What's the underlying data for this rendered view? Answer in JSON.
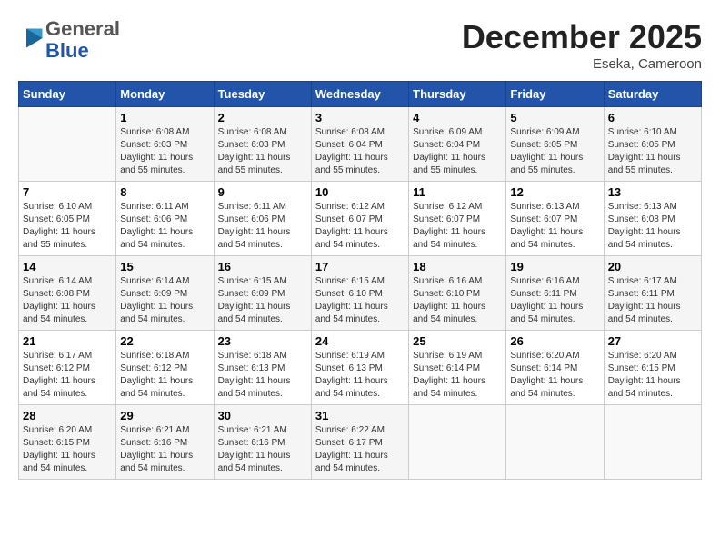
{
  "header": {
    "logo_general": "General",
    "logo_blue": "Blue",
    "month_title": "December 2025",
    "location": "Eseka, Cameroon"
  },
  "days_of_week": [
    "Sunday",
    "Monday",
    "Tuesday",
    "Wednesday",
    "Thursday",
    "Friday",
    "Saturday"
  ],
  "weeks": [
    [
      {
        "day": "",
        "info": ""
      },
      {
        "day": "1",
        "info": "Sunrise: 6:08 AM\nSunset: 6:03 PM\nDaylight: 11 hours and 55 minutes."
      },
      {
        "day": "2",
        "info": "Sunrise: 6:08 AM\nSunset: 6:03 PM\nDaylight: 11 hours and 55 minutes."
      },
      {
        "day": "3",
        "info": "Sunrise: 6:08 AM\nSunset: 6:04 PM\nDaylight: 11 hours and 55 minutes."
      },
      {
        "day": "4",
        "info": "Sunrise: 6:09 AM\nSunset: 6:04 PM\nDaylight: 11 hours and 55 minutes."
      },
      {
        "day": "5",
        "info": "Sunrise: 6:09 AM\nSunset: 6:05 PM\nDaylight: 11 hours and 55 minutes."
      },
      {
        "day": "6",
        "info": "Sunrise: 6:10 AM\nSunset: 6:05 PM\nDaylight: 11 hours and 55 minutes."
      }
    ],
    [
      {
        "day": "7",
        "info": "Sunrise: 6:10 AM\nSunset: 6:05 PM\nDaylight: 11 hours and 55 minutes."
      },
      {
        "day": "8",
        "info": "Sunrise: 6:11 AM\nSunset: 6:06 PM\nDaylight: 11 hours and 54 minutes."
      },
      {
        "day": "9",
        "info": "Sunrise: 6:11 AM\nSunset: 6:06 PM\nDaylight: 11 hours and 54 minutes."
      },
      {
        "day": "10",
        "info": "Sunrise: 6:12 AM\nSunset: 6:07 PM\nDaylight: 11 hours and 54 minutes."
      },
      {
        "day": "11",
        "info": "Sunrise: 6:12 AM\nSunset: 6:07 PM\nDaylight: 11 hours and 54 minutes."
      },
      {
        "day": "12",
        "info": "Sunrise: 6:13 AM\nSunset: 6:07 PM\nDaylight: 11 hours and 54 minutes."
      },
      {
        "day": "13",
        "info": "Sunrise: 6:13 AM\nSunset: 6:08 PM\nDaylight: 11 hours and 54 minutes."
      }
    ],
    [
      {
        "day": "14",
        "info": "Sunrise: 6:14 AM\nSunset: 6:08 PM\nDaylight: 11 hours and 54 minutes."
      },
      {
        "day": "15",
        "info": "Sunrise: 6:14 AM\nSunset: 6:09 PM\nDaylight: 11 hours and 54 minutes."
      },
      {
        "day": "16",
        "info": "Sunrise: 6:15 AM\nSunset: 6:09 PM\nDaylight: 11 hours and 54 minutes."
      },
      {
        "day": "17",
        "info": "Sunrise: 6:15 AM\nSunset: 6:10 PM\nDaylight: 11 hours and 54 minutes."
      },
      {
        "day": "18",
        "info": "Sunrise: 6:16 AM\nSunset: 6:10 PM\nDaylight: 11 hours and 54 minutes."
      },
      {
        "day": "19",
        "info": "Sunrise: 6:16 AM\nSunset: 6:11 PM\nDaylight: 11 hours and 54 minutes."
      },
      {
        "day": "20",
        "info": "Sunrise: 6:17 AM\nSunset: 6:11 PM\nDaylight: 11 hours and 54 minutes."
      }
    ],
    [
      {
        "day": "21",
        "info": "Sunrise: 6:17 AM\nSunset: 6:12 PM\nDaylight: 11 hours and 54 minutes."
      },
      {
        "day": "22",
        "info": "Sunrise: 6:18 AM\nSunset: 6:12 PM\nDaylight: 11 hours and 54 minutes."
      },
      {
        "day": "23",
        "info": "Sunrise: 6:18 AM\nSunset: 6:13 PM\nDaylight: 11 hours and 54 minutes."
      },
      {
        "day": "24",
        "info": "Sunrise: 6:19 AM\nSunset: 6:13 PM\nDaylight: 11 hours and 54 minutes."
      },
      {
        "day": "25",
        "info": "Sunrise: 6:19 AM\nSunset: 6:14 PM\nDaylight: 11 hours and 54 minutes."
      },
      {
        "day": "26",
        "info": "Sunrise: 6:20 AM\nSunset: 6:14 PM\nDaylight: 11 hours and 54 minutes."
      },
      {
        "day": "27",
        "info": "Sunrise: 6:20 AM\nSunset: 6:15 PM\nDaylight: 11 hours and 54 minutes."
      }
    ],
    [
      {
        "day": "28",
        "info": "Sunrise: 6:20 AM\nSunset: 6:15 PM\nDaylight: 11 hours and 54 minutes."
      },
      {
        "day": "29",
        "info": "Sunrise: 6:21 AM\nSunset: 6:16 PM\nDaylight: 11 hours and 54 minutes."
      },
      {
        "day": "30",
        "info": "Sunrise: 6:21 AM\nSunset: 6:16 PM\nDaylight: 11 hours and 54 minutes."
      },
      {
        "day": "31",
        "info": "Sunrise: 6:22 AM\nSunset: 6:17 PM\nDaylight: 11 hours and 54 minutes."
      },
      {
        "day": "",
        "info": ""
      },
      {
        "day": "",
        "info": ""
      },
      {
        "day": "",
        "info": ""
      }
    ]
  ]
}
